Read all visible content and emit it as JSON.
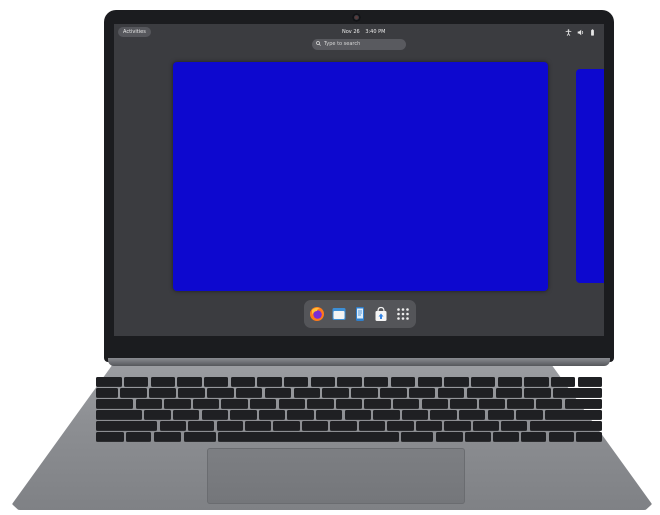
{
  "topbar": {
    "activities": "Activities",
    "date": "Nov 26",
    "time": "3:40 PM"
  },
  "search": {
    "placeholder": "Type to search"
  },
  "dock": {
    "apps": [
      "firefox-icon",
      "files-icon",
      "text-editor-icon",
      "software-store-icon",
      "app-grid-icon"
    ]
  },
  "colors": {
    "desktop": "#3b3c40",
    "window": "#0d08cf",
    "dock": "#545559",
    "chassis": "#8d8f93",
    "bezel": "#1b1c1f"
  }
}
